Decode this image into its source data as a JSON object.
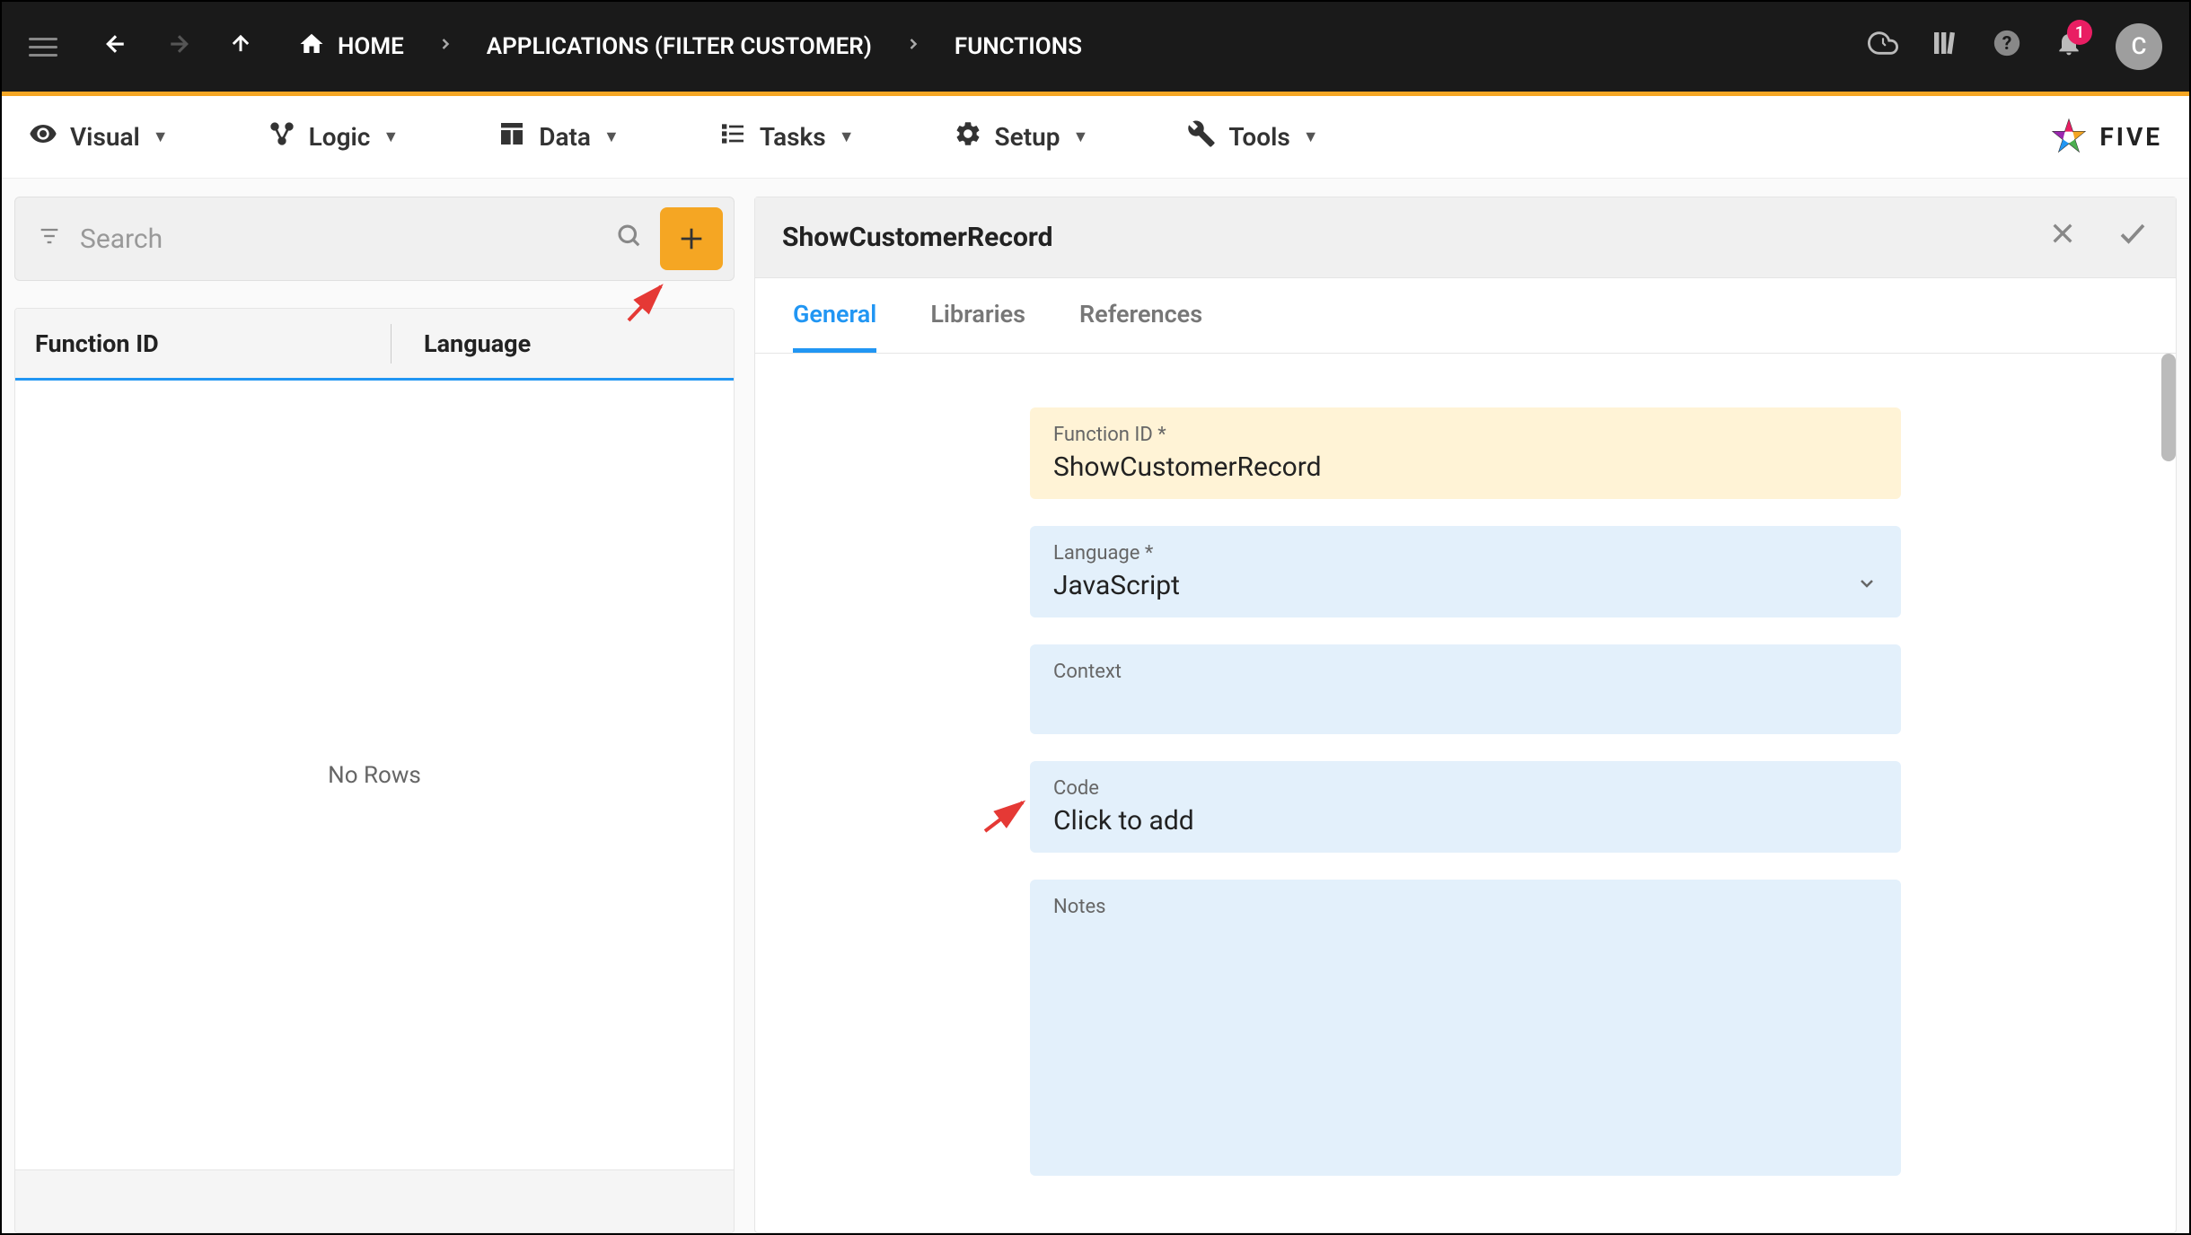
{
  "topbar": {
    "breadcrumb": [
      {
        "label": "HOME",
        "icon": "home"
      },
      {
        "label": "APPLICATIONS (FILTER CUSTOMER)"
      },
      {
        "label": "FUNCTIONS"
      }
    ],
    "notification_count": "1",
    "avatar_initial": "C"
  },
  "menubar": {
    "items": [
      {
        "label": "Visual",
        "icon": "eye"
      },
      {
        "label": "Logic",
        "icon": "flow"
      },
      {
        "label": "Data",
        "icon": "table"
      },
      {
        "label": "Tasks",
        "icon": "list"
      },
      {
        "label": "Setup",
        "icon": "gear"
      },
      {
        "label": "Tools",
        "icon": "tools"
      }
    ],
    "logo_text": "FIVE"
  },
  "left_panel": {
    "search_placeholder": "Search",
    "columns": [
      "Function ID",
      "Language"
    ],
    "no_rows": "No Rows"
  },
  "right_panel": {
    "title": "ShowCustomerRecord",
    "tabs": [
      "General",
      "Libraries",
      "References"
    ],
    "active_tab": 0,
    "fields": {
      "function_id": {
        "label": "Function ID *",
        "value": "ShowCustomerRecord"
      },
      "language": {
        "label": "Language *",
        "value": "JavaScript"
      },
      "context": {
        "label": "Context",
        "value": ""
      },
      "code": {
        "label": "Code",
        "value": "Click to add"
      },
      "notes": {
        "label": "Notes",
        "value": ""
      }
    }
  }
}
